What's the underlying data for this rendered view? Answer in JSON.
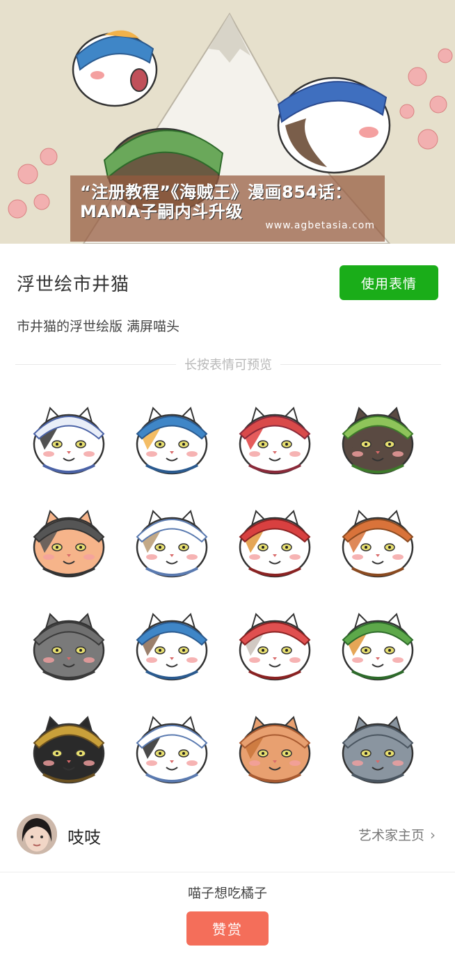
{
  "banner": {
    "headline_line1": "“注册教程”《海贼王》漫画854话：",
    "headline_line2": "MAMA子嗣内斗升级",
    "watermark_url": "www.agbetasia.com"
  },
  "pack": {
    "title": "浮世绘市井猫",
    "description": "市井猫的浮世绘版 满屏喵头",
    "use_button": "使用表情",
    "preview_hint": "长按表情可预览"
  },
  "stickers": [
    {
      "name": "cat-blue-plaid-hood",
      "hood": "#e9eef8",
      "hoodStroke": "#4a62a6",
      "face": "#ffffff",
      "patch": "#333333"
    },
    {
      "name": "cat-blue-bandana-yelling",
      "hood": "#3f86c7",
      "hoodStroke": "#2a5a8f",
      "face": "#ffffff",
      "patch": "#f2b24a"
    },
    {
      "name": "cat-kabuki-red",
      "hood": "#d94a4a",
      "hoodStroke": "#8a2a3a",
      "face": "#ffffff",
      "patch": "#e04040"
    },
    {
      "name": "cat-green-hood-dark",
      "hood": "#8ec45a",
      "hoodStroke": "#3d7a2a",
      "face": "#5a4a42",
      "patch": "#5a4a42"
    },
    {
      "name": "cat-grey-round-face",
      "hood": "#555555",
      "hoodStroke": "#333333",
      "face": "#f6b48a",
      "patch": "#555555"
    },
    {
      "name": "cat-striped-scarf",
      "hood": "#ffffff",
      "hoodStroke": "#5a7ab0",
      "face": "#ffffff",
      "patch": "#b89a72"
    },
    {
      "name": "cat-calico-red-scarf",
      "hood": "#d84040",
      "hoodStroke": "#8a2222",
      "face": "#ffffff",
      "patch": "#e0963a"
    },
    {
      "name": "cat-orange-striped-sad",
      "hood": "#d9733a",
      "hoodStroke": "#8a4a20",
      "face": "#ffffff",
      "patch": "#d9733a"
    },
    {
      "name": "cat-grey-angry",
      "hood": "#707070",
      "hoodStroke": "#3a3a3a",
      "face": "#7a7a7a",
      "patch": "#7a7a7a"
    },
    {
      "name": "cat-blue-bandana-tabby",
      "hood": "#3f86c7",
      "hoodStroke": "#2a5a8f",
      "face": "#ffffff",
      "patch": "#8a6a52"
    },
    {
      "name": "cat-orange-on-head",
      "hood": "#e05050",
      "hoodStroke": "#8a2222",
      "face": "#ffffff",
      "patch": "#c9c0b8"
    },
    {
      "name": "cat-green-hood-calico",
      "hood": "#5da84a",
      "hoodStroke": "#2d6a2a",
      "face": "#ffffff",
      "patch": "#e0963a"
    },
    {
      "name": "cat-black-gold-hood",
      "hood": "#c9a03a",
      "hoodStroke": "#6a5020",
      "face": "#2a2a2a",
      "patch": "#2a2a2a"
    },
    {
      "name": "cat-black-white-confused",
      "hood": "#ffffff",
      "hoodStroke": "#5a7ab0",
      "face": "#ffffff",
      "patch": "#2a2a2a"
    },
    {
      "name": "cat-orange-tabby-crying",
      "hood": "#e8a070",
      "hoodStroke": "#a85a30",
      "face": "#e8a070",
      "patch": "#c9763a"
    },
    {
      "name": "cat-grey-sweating",
      "hood": "#8a95a0",
      "hoodStroke": "#4a5560",
      "face": "#8a95a0",
      "patch": "#8a95a0"
    }
  ],
  "artist": {
    "name": "吱吱",
    "homepage_link": "艺术家主页"
  },
  "reward": {
    "message": "喵子想吃橘子",
    "button": "赞赏"
  },
  "colors": {
    "primary_green": "#1aad19",
    "reward_red": "#f46e5a",
    "overlay_brown": "#965a3e"
  }
}
